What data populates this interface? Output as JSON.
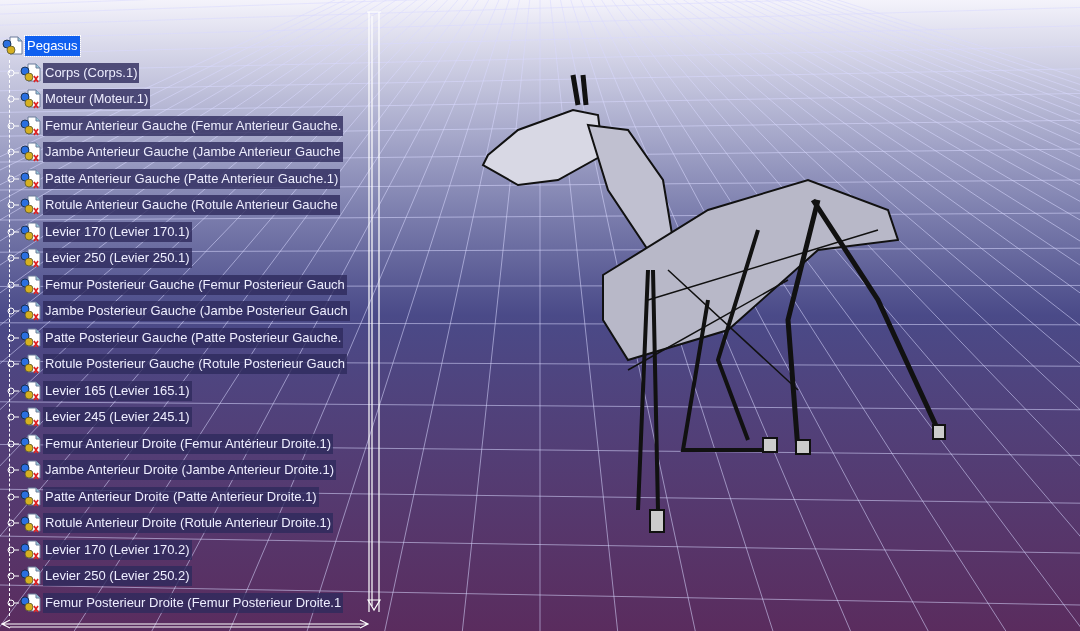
{
  "tree": {
    "label": "Pegasus",
    "selected": true,
    "children": [
      {
        "label": "Corps (Corps.1)",
        "selected": false
      },
      {
        "label": "Moteur (Moteur.1)",
        "selected": false
      },
      {
        "label": "Femur Anterieur Gauche (Femur Anterieur Gauche.",
        "selected": false
      },
      {
        "label": "Jambe Anterieur Gauche (Jambe Anterieur Gauche",
        "selected": false
      },
      {
        "label": "Patte Anterieur Gauche (Patte Anterieur Gauche.1)",
        "selected": false
      },
      {
        "label": "Rotule Anterieur Gauche (Rotule Anterieur Gauche",
        "selected": false
      },
      {
        "label": "Levier 170 (Levier 170.1)",
        "selected": false
      },
      {
        "label": "Levier 250 (Levier 250.1)",
        "selected": false
      },
      {
        "label": "Femur Posterieur Gauche (Femur Posterieur Gauch",
        "selected": false
      },
      {
        "label": "Jambe Posterieur Gauche (Jambe Posterieur Gauch",
        "selected": false
      },
      {
        "label": "Patte Posterieur Gauche (Patte Posterieur Gauche.",
        "selected": false
      },
      {
        "label": "Rotule Posterieur Gauche (Rotule Posterieur Gauch",
        "selected": false
      },
      {
        "label": "Levier 165 (Levier 165.1)",
        "selected": false
      },
      {
        "label": "Levier 245 (Levier 245.1)",
        "selected": false
      },
      {
        "label": "Femur Anterieur Droite (Femur Antérieur Droite.1)",
        "selected": false
      },
      {
        "label": "Jambe Anterieur Droite (Jambe Anterieur Droite.1)",
        "selected": false
      },
      {
        "label": "Patte Anterieur Droite (Patte Anterieur Droite.1)",
        "selected": false
      },
      {
        "label": "Rotule Anterieur Droite (Rotule Anterieur Droite.1)",
        "selected": false
      },
      {
        "label": "Levier 170 (Levier 170.2)",
        "selected": false
      },
      {
        "label": "Levier 250 (Levier 250.2)",
        "selected": false
      },
      {
        "label": "Femur Posterieur Droite (Femur Posterieur Droite.1",
        "selected": false
      }
    ]
  }
}
